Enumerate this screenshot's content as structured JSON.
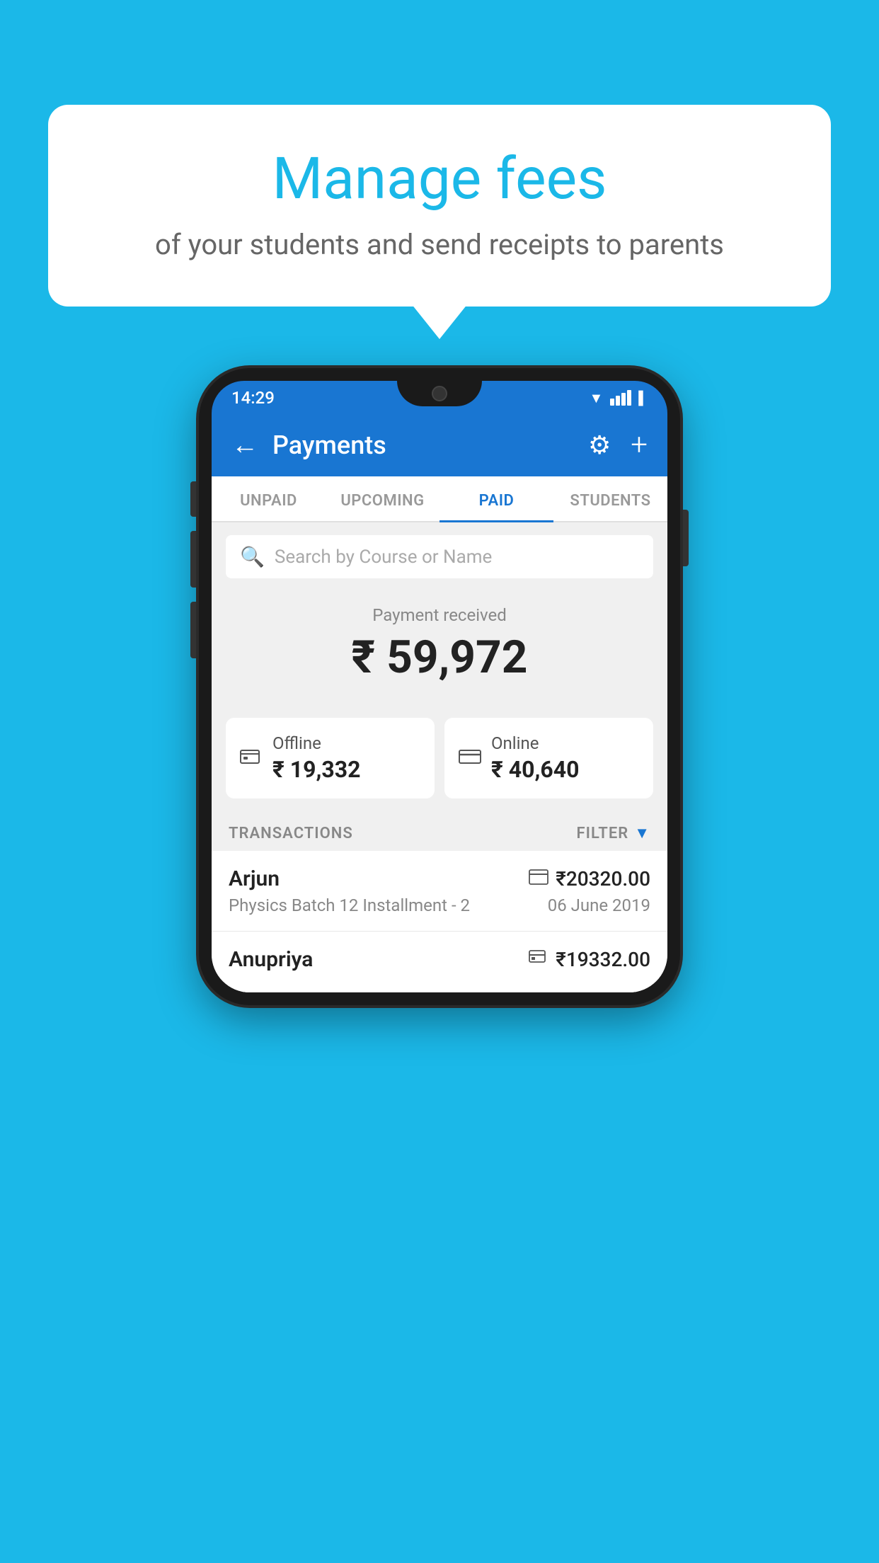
{
  "background_color": "#1BB8E8",
  "speech_bubble": {
    "title": "Manage fees",
    "subtitle": "of your students and send receipts to parents"
  },
  "status_bar": {
    "time": "14:29",
    "wifi_icon": "wifi",
    "signal_icon": "signal",
    "battery_icon": "battery"
  },
  "header": {
    "back_icon": "←",
    "title": "Payments",
    "settings_icon": "⚙",
    "add_icon": "+"
  },
  "tabs": [
    {
      "label": "UNPAID",
      "active": false
    },
    {
      "label": "UPCOMING",
      "active": false
    },
    {
      "label": "PAID",
      "active": true
    },
    {
      "label": "STUDENTS",
      "active": false
    }
  ],
  "search": {
    "placeholder": "Search by Course or Name",
    "search_icon": "🔍"
  },
  "payment_summary": {
    "label": "Payment received",
    "amount": "₹ 59,972",
    "offline": {
      "label": "Offline",
      "amount": "₹ 19,332",
      "icon": "offline-payment"
    },
    "online": {
      "label": "Online",
      "amount": "₹ 40,640",
      "icon": "credit-card"
    }
  },
  "transactions_section": {
    "label": "TRANSACTIONS",
    "filter_label": "FILTER"
  },
  "transactions": [
    {
      "name": "Arjun",
      "payment_type": "card",
      "amount": "₹20320.00",
      "course": "Physics Batch 12 Installment - 2",
      "date": "06 June 2019"
    },
    {
      "name": "Anupriya",
      "payment_type": "offline",
      "amount": "₹19332.00",
      "course": "",
      "date": ""
    }
  ]
}
